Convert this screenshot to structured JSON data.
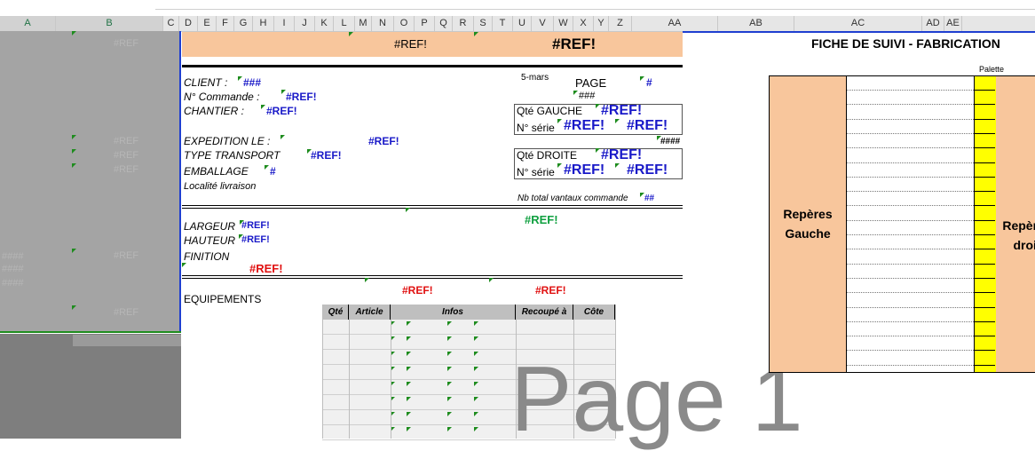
{
  "columns": [
    "A",
    "B",
    "C",
    "D",
    "E",
    "F",
    "G",
    "H",
    "I",
    "J",
    "K",
    "L",
    "M",
    "N",
    "O",
    "P",
    "Q",
    "R",
    "S",
    "T",
    "U",
    "V",
    "W",
    "X",
    "Y",
    "Z",
    "AA",
    "AB",
    "AC",
    "AD",
    "AE"
  ],
  "header": {
    "ref_small": "#REF!",
    "ref_big": "#REF!"
  },
  "client": {
    "client_label": "CLIENT :",
    "client_value": "###",
    "commande_label": "N° Commande :",
    "commande_value": "#REF!",
    "chantier_label": "CHANTIER :",
    "chantier_value": "#REF!",
    "date": "5-mars",
    "page_label": "PAGE",
    "page_value": "#",
    "page_hash": "###"
  },
  "gauche": {
    "qte_label": "Qté GAUCHE",
    "qte_value": "#REF!",
    "serie_label": "N° série",
    "serie_value1": "#REF!",
    "serie_value2": "#REF!"
  },
  "droite": {
    "qte_label": "Qté DROITE",
    "qte_value": "#REF!",
    "serie_label": "N° série",
    "serie_value1": "#REF!",
    "serie_value2": "#REF!"
  },
  "hash4": "####",
  "expedition": {
    "expedition_label": "EXPEDITION LE :",
    "expedition_value": "#REF!",
    "transport_label": "TYPE TRANSPORT",
    "transport_value": "#REF!",
    "emballage_label": "EMBALLAGE",
    "emballage_value": "#",
    "localite_label": "Localité livraison",
    "nb_total_label": "Nb total vantaux commande",
    "nb_total_value": "##"
  },
  "dims": {
    "largeur_label": "LARGEUR",
    "largeur_value": "#REF!",
    "hauteur_label": "HAUTEUR",
    "hauteur_value": "#REF!",
    "finition_label": "FINITION",
    "finition_value": "#REF!",
    "green_ref": "#REF!"
  },
  "equip": {
    "label": "EQUIPEMENTS",
    "ref1": "#REF!",
    "ref2": "#REF!",
    "headers": [
      "Qté",
      "Article",
      "Infos",
      "Recoupé à",
      "Côte"
    ]
  },
  "watermark": "Page 1",
  "fiche": {
    "title": "FICHE DE SUIVI - FABRICATION",
    "palette": "Palette",
    "reperes_gauche": "Repères Gauche",
    "reperes_droit": "Repères droit"
  },
  "colors": {
    "salmon": "#f8c69c",
    "yellow": "#ffff00",
    "ref_blue": "#1919c8",
    "ref_red": "#e01010",
    "ref_green": "#10a040"
  }
}
